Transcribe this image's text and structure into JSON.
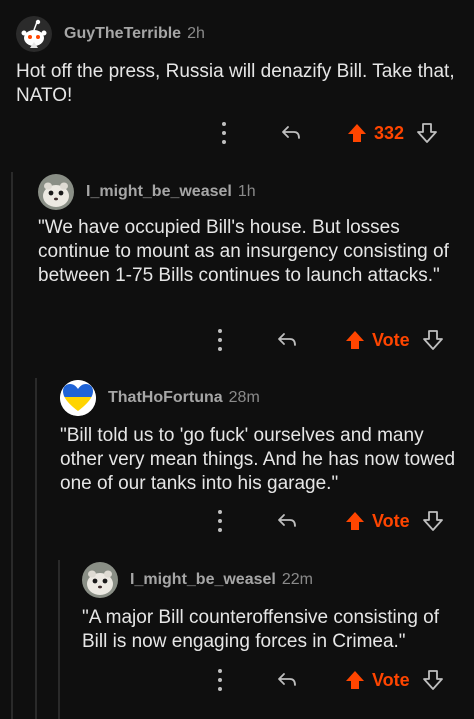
{
  "comments": [
    {
      "username": "GuyTheTerrible",
      "time": "2h",
      "avatar_icon": "reddit-snoo-avatar",
      "body": "Hot off the press, Russia will denazify Bill. Take that, NATO!",
      "score": "332",
      "upvoted": true
    },
    {
      "username": "I_might_be_weasel",
      "time": "1h",
      "avatar_icon": "weasel-avatar",
      "body": "\"We have occupied Bill's house. But losses continue to mount as an insurgency consisting of between 1-75 Bills continues to launch attacks.\"",
      "score": "Vote",
      "upvoted": false
    },
    {
      "username": "ThatHoFortuna",
      "time": "28m",
      "avatar_icon": "ukraine-heart-avatar",
      "body": "\"Bill told us to 'go fuck' ourselves and many other very mean things.  And he has now towed one of our tanks into his garage.\"",
      "score": "Vote",
      "upvoted": false
    },
    {
      "username": "I_might_be_weasel",
      "time": "22m",
      "avatar_icon": "weasel-avatar",
      "body": "\"A major Bill counteroffensive consisting of Bill is now engaging forces in Crimea.\"",
      "score": "Vote",
      "upvoted": false
    }
  ],
  "colors": {
    "background": "#0f0f0f",
    "accent_orange": "#ff4500",
    "text": "#e6e6e6",
    "muted": "#a6a6a6"
  }
}
